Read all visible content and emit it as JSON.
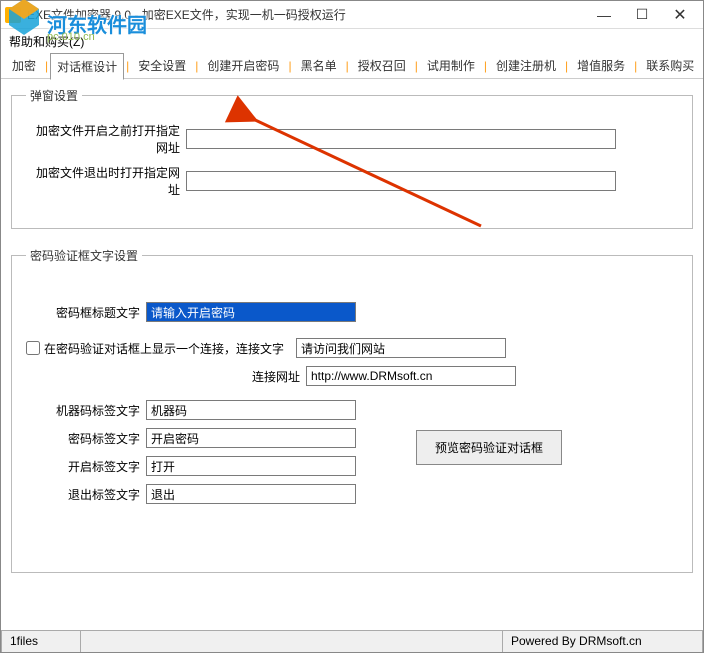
{
  "window": {
    "title": "EXE文件加密器 9.0 - 加密EXE文件，实现一机一码授权运行",
    "min": "—",
    "max": "☐",
    "close": "✕"
  },
  "menu": {
    "help": "帮助和购买(Z)"
  },
  "watermark": {
    "text": "河东软件园",
    "sub": "pc.010.cn"
  },
  "tabs": {
    "t0": "加密",
    "t1": "对话框设计",
    "t2": "安全设置",
    "t3": "创建开启密码",
    "t4": "黑名单",
    "t5": "授权召回",
    "t6": "试用制作",
    "t7": "创建注册机",
    "t8": "增值服务",
    "t9": "联系购买"
  },
  "group1": {
    "legend": "弹窗设置",
    "label_before": "加密文件开启之前打开指定网址",
    "label_exit": "加密文件退出时打开指定网址",
    "val_before": "",
    "val_exit": ""
  },
  "group2": {
    "legend": "密码验证框文字设置",
    "label_title": "密码框标题文字",
    "val_title": "请输入开启密码",
    "chk_label": "在密码验证对话框上显示一个连接，连接文字",
    "link_text": "请访问我们网站",
    "label_link_url": "连接网址",
    "link_url": "http://www.DRMsoft.cn",
    "label_machine": "机器码标签文字",
    "val_machine": "机器码",
    "label_pwd": "密码标签文字",
    "val_pwd": "开启密码",
    "label_open": "开启标签文字",
    "val_open": "打开",
    "label_exit": "退出标签文字",
    "val_exit": "退出",
    "btn_preview": "预览密码验证对话框"
  },
  "status": {
    "left": "1files",
    "right": "Powered By DRMsoft.cn"
  }
}
